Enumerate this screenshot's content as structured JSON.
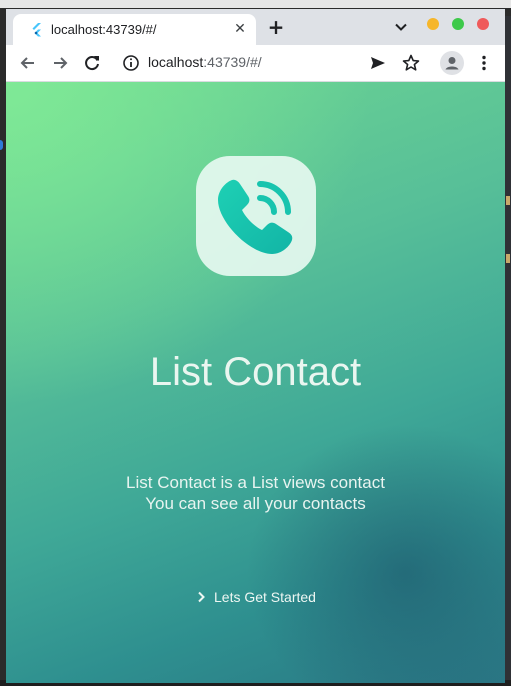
{
  "browser": {
    "tab_title": "localhost:43739/#/",
    "url_host": "localhost",
    "url_rest": ":43739/#/"
  },
  "app": {
    "title": "List Contact",
    "description_line1": "List Contact is a List views contact",
    "description_line2": "You can see all your contacts",
    "cta_label": "Lets Get Started",
    "logo_icon": "phone-call-icon"
  },
  "colors": {
    "gradient_start": "#7de696",
    "gradient_end": "#2a7684",
    "logo_bg": "#e6f8f0",
    "phone_icon": "#1cc7b0"
  }
}
